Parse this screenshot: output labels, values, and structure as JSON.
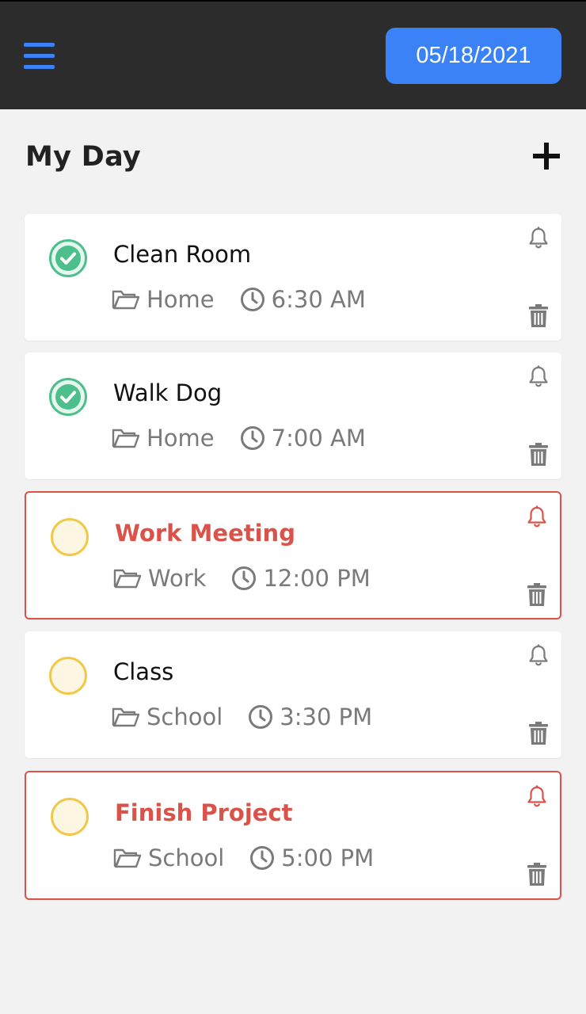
{
  "header": {
    "date": "05/18/2021",
    "menu_icon": "hamburger-menu-icon"
  },
  "page": {
    "title": "My Day",
    "add_icon": "plus-icon"
  },
  "colors": {
    "accent": "#3b82f6",
    "header_bg": "#2c2c2c",
    "done": "#4dbf8c",
    "pending": "#f0c94a",
    "urgent": "#d9534a",
    "muted": "#7a7a7a"
  },
  "tasks": [
    {
      "title": "Clean Room",
      "category": "Home",
      "time": "6:30 AM",
      "status": "done",
      "urgent": false
    },
    {
      "title": "Walk Dog",
      "category": "Home",
      "time": "7:00 AM",
      "status": "done",
      "urgent": false
    },
    {
      "title": "Work Meeting",
      "category": "Work",
      "time": "12:00 PM",
      "status": "pending",
      "urgent": true
    },
    {
      "title": "Class",
      "category": "School",
      "time": "3:30 PM",
      "status": "pending",
      "urgent": false
    },
    {
      "title": "Finish Project",
      "category": "School",
      "time": "5:00 PM",
      "status": "pending",
      "urgent": true
    }
  ]
}
